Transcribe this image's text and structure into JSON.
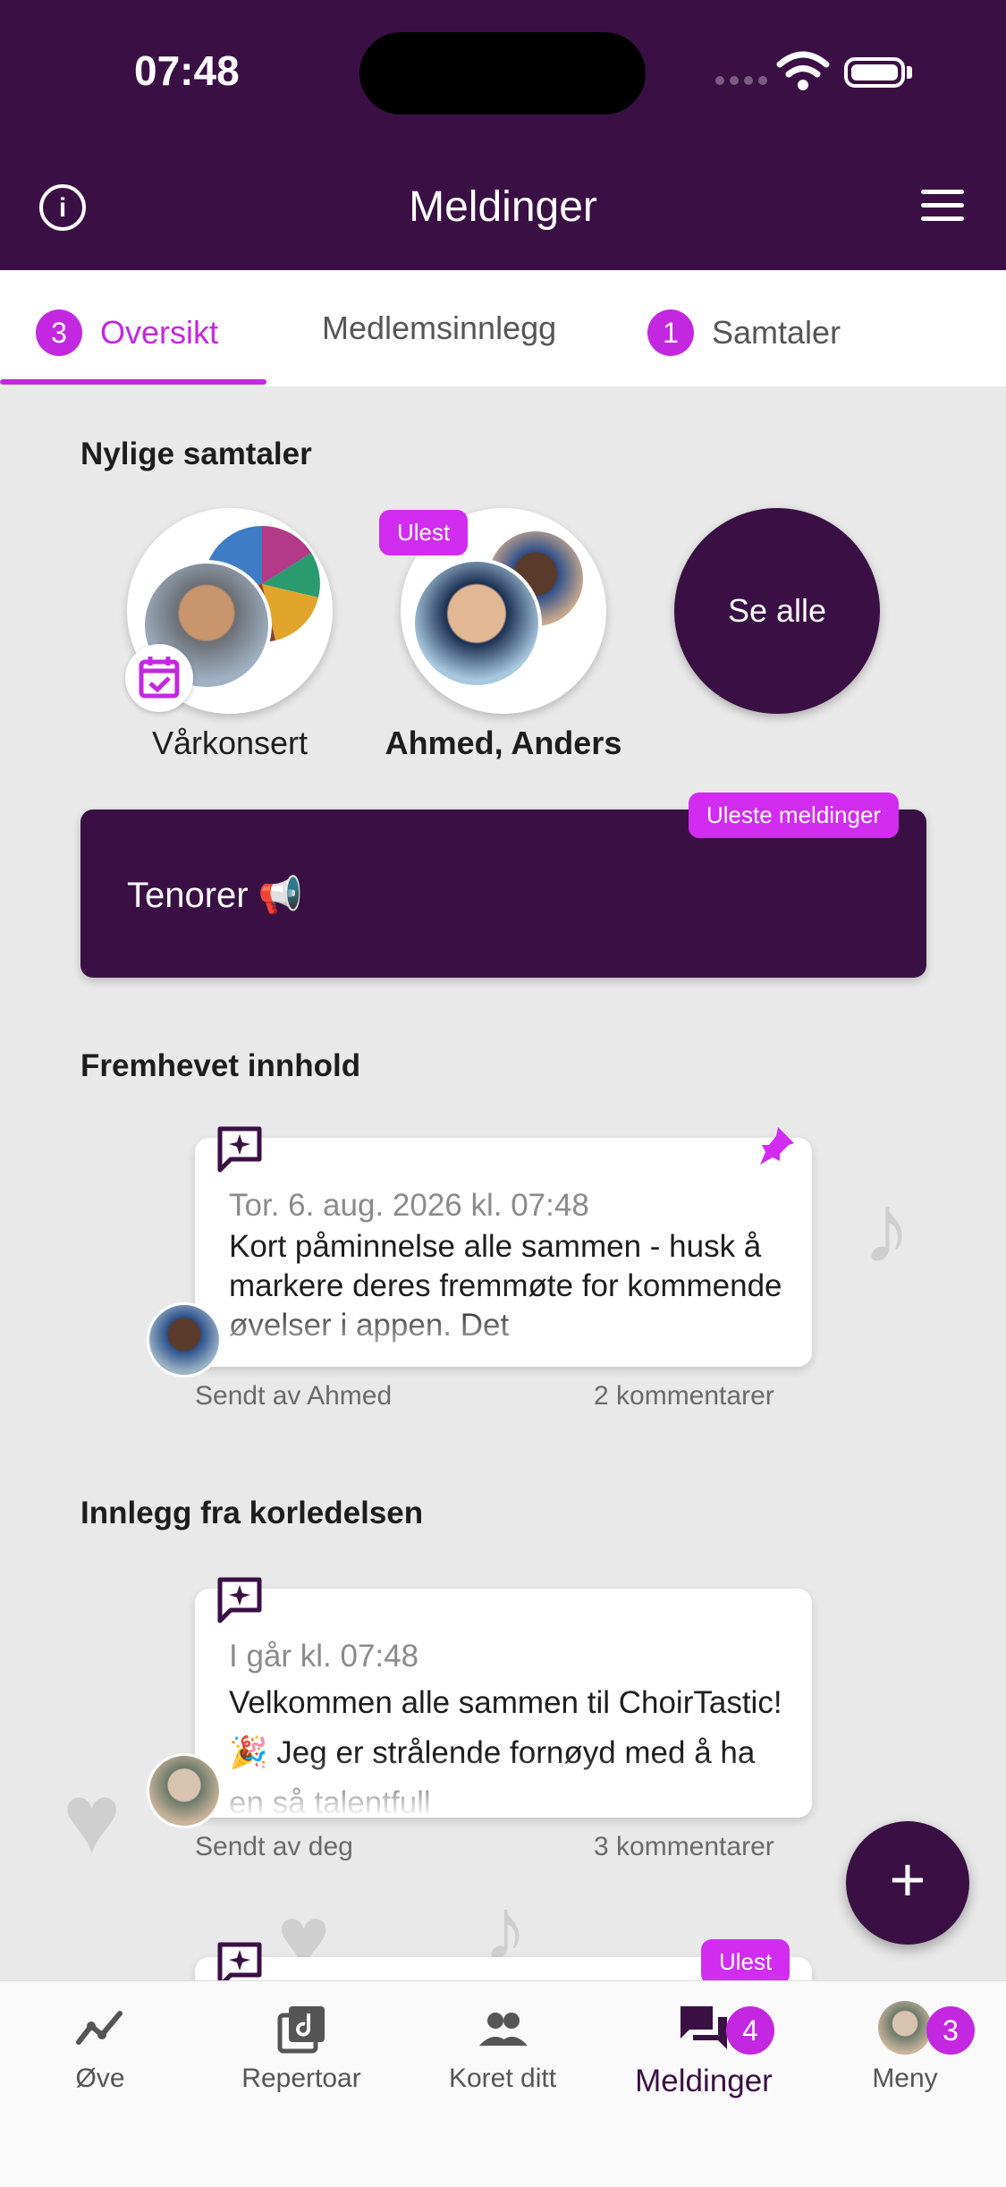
{
  "status_bar": {
    "time": "07:48"
  },
  "header": {
    "title": "Meldinger"
  },
  "tabs": [
    {
      "label": "Oversikt",
      "badge": "3",
      "active": true
    },
    {
      "label": "Medlemsinnlegg"
    },
    {
      "label": "Samtaler",
      "badge": "1"
    }
  ],
  "recent": {
    "title": "Nylige samtaler",
    "items": [
      {
        "label": "Vårkonsert",
        "icon": "calendar-check-icon"
      },
      {
        "label": "Ahmed, Anders",
        "tag": "Ulest"
      }
    ],
    "see_all": "Se alle"
  },
  "channel": {
    "name": "Tenorer 📢",
    "tag": "Uleste meldinger"
  },
  "featured": {
    "title": "Fremhevet innhold",
    "post": {
      "date": "Tor. 6. aug. 2026 kl. 07:48",
      "text": "Kort påminnelse alle sammen - husk å markere deres fremmøte for kommende øvelser i appen. Det",
      "author": "Sendt av Ahmed",
      "comments": "2 kommentarer"
    }
  },
  "leadership": {
    "title": "Innlegg fra korledelsen",
    "post": {
      "date": "I går kl. 07:48",
      "text": "Velkommen alle sammen til ChoirTastic! 🎉 Jeg er strålende fornøyd med å ha en så talentfull",
      "author": "Sendt av deg",
      "comments": "3 kommentarer"
    },
    "next_tag": "Ulest"
  },
  "fab_label": "+",
  "nav": [
    {
      "label": "Øve",
      "icon": "practice-icon"
    },
    {
      "label": "Repertoar",
      "icon": "music-library-icon"
    },
    {
      "label": "Koret ditt",
      "icon": "group-icon"
    },
    {
      "label": "Meldinger",
      "icon": "chat-icon",
      "badge": "4",
      "active": true
    },
    {
      "label": "Meny",
      "icon": "avatar-menu-icon",
      "badge": "3"
    }
  ],
  "colors": {
    "primary": "#3a1044",
    "accent": "#c328e0",
    "tag": "#d22cf0"
  }
}
